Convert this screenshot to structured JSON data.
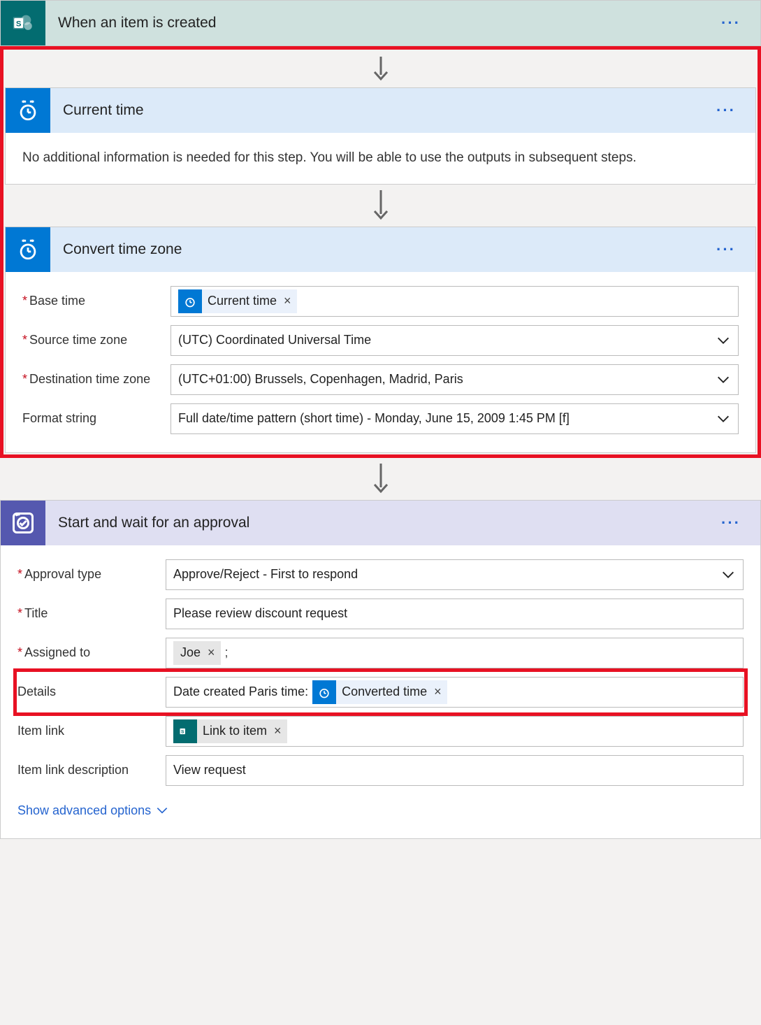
{
  "trigger": {
    "title": "When an item is created"
  },
  "current_time": {
    "title": "Current time",
    "info": "No additional information is needed for this step. You will be able to use the outputs in subsequent steps."
  },
  "convert_tz": {
    "title": "Convert time zone",
    "rows": {
      "base_time": {
        "label": "Base time",
        "token": "Current time"
      },
      "source_tz": {
        "label": "Source time zone",
        "value": "(UTC) Coordinated Universal Time"
      },
      "dest_tz": {
        "label": "Destination time zone",
        "value": "(UTC+01:00) Brussels, Copenhagen, Madrid, Paris"
      },
      "format": {
        "label": "Format string",
        "value": "Full date/time pattern (short time) - Monday, June 15, 2009 1:45 PM [f]"
      }
    }
  },
  "approval": {
    "title": "Start and wait for an approval",
    "rows": {
      "type": {
        "label": "Approval type",
        "value": "Approve/Reject - First to respond"
      },
      "title": {
        "label": "Title",
        "value": "Please review discount request"
      },
      "assigned": {
        "label": "Assigned to",
        "token": "Joe",
        "suffix": ";"
      },
      "details": {
        "label": "Details",
        "prefix": "Date created Paris time:",
        "token": "Converted time"
      },
      "link": {
        "label": "Item link",
        "token": "Link to item"
      },
      "link_desc": {
        "label": "Item link description",
        "value": "View request"
      }
    },
    "advanced": "Show advanced options"
  }
}
